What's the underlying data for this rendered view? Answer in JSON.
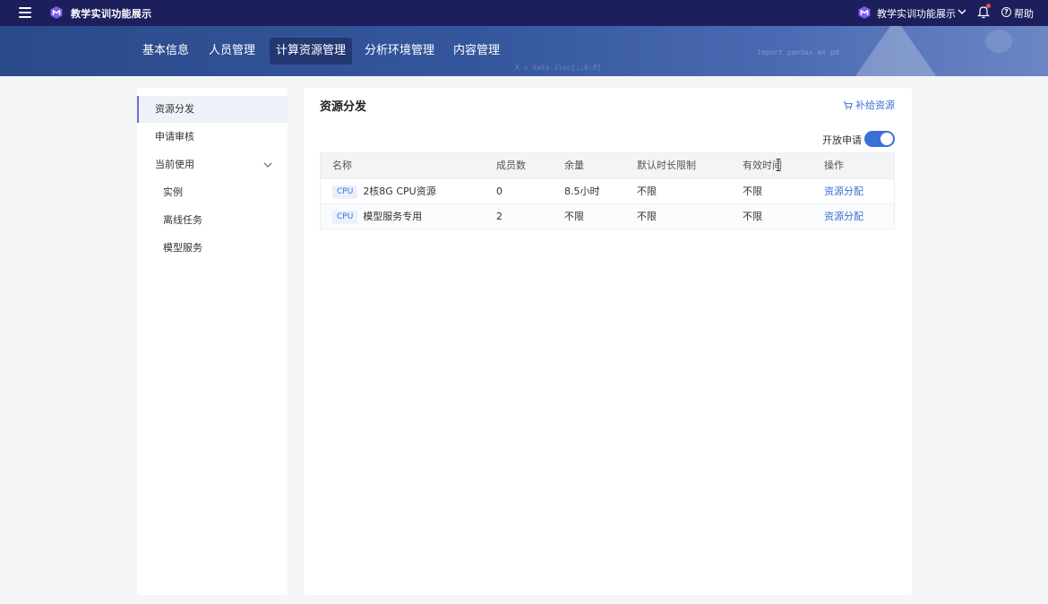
{
  "app": {
    "title": "教学实训功能展示",
    "workspace": "教学实训功能展示",
    "help": "帮助"
  },
  "nav": {
    "tabs": [
      {
        "label": "基本信息"
      },
      {
        "label": "人员管理"
      },
      {
        "label": "计算资源管理",
        "active": true
      },
      {
        "label": "分析环境管理"
      },
      {
        "label": "内容管理"
      }
    ]
  },
  "banner": {
    "code1": "import pandas as pd",
    "code2": "X = data.iloc[:,0:8]"
  },
  "sidebar": {
    "items": [
      {
        "label": "资源分发"
      },
      {
        "label": "申请审核"
      },
      {
        "label": "当前使用"
      },
      {
        "label": "实例"
      },
      {
        "label": "离线任务"
      },
      {
        "label": "模型服务"
      }
    ]
  },
  "main": {
    "title": "资源分发",
    "supply_label": "补给资源",
    "open_apply_label": "开放申请",
    "open_apply_on": true
  },
  "table": {
    "headers": [
      "名称",
      "成员数",
      "余量",
      "默认时长限制",
      "有效时间",
      "操作"
    ],
    "rows": [
      {
        "tag": "CPU",
        "name": "2核8G CPU资源",
        "members": "0",
        "remaining": "8.5小时",
        "default_limit": "不限",
        "valid_time": "不限",
        "action": "资源分配"
      },
      {
        "tag": "CPU",
        "name": "模型服务专用",
        "members": "2",
        "remaining": "不限",
        "default_limit": "不限",
        "valid_time": "不限",
        "action": "资源分配"
      }
    ]
  },
  "colors": {
    "topbar": "#1c1f5c",
    "accent": "#3d6fd8",
    "sidebar_active": "#6b6fd4",
    "badge": "#f04b4b"
  }
}
